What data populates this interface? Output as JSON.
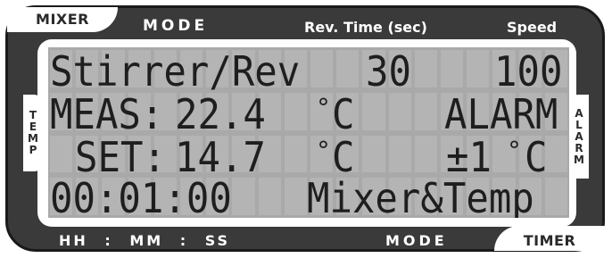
{
  "panel": {
    "tab_mixer": "MIXER",
    "tab_timer": "TIMER",
    "top_labels": {
      "mode": "MODE",
      "rev_time": "Rev. Time (sec)",
      "speed": "Speed"
    },
    "bottom_labels": {
      "time_format": "HH : MM : SS",
      "mode": "MODE"
    },
    "side_left": [
      "T",
      "E",
      "M",
      "P"
    ],
    "side_right": [
      "A",
      "L",
      "A",
      "R",
      "M"
    ]
  },
  "display": {
    "row1": {
      "mode": "Stirrer/Rev",
      "rev_time": "30",
      "speed": "100"
    },
    "row2": {
      "label": "MEAS:",
      "value": "22.4",
      "unit": "C",
      "status": "ALARM"
    },
    "row3": {
      "label": "SET:",
      "value": "14.7",
      "unit": "C",
      "alarm_band": "±1",
      "alarm_unit": "C"
    },
    "row4": {
      "timer": "00:01:00",
      "mode": "Mixer&Temp"
    },
    "degree_symbol": "°"
  },
  "colors": {
    "panel": "#3a3a3a",
    "lcd_background": "#a9a9a9",
    "lcd_text": "#1e1e1e"
  }
}
